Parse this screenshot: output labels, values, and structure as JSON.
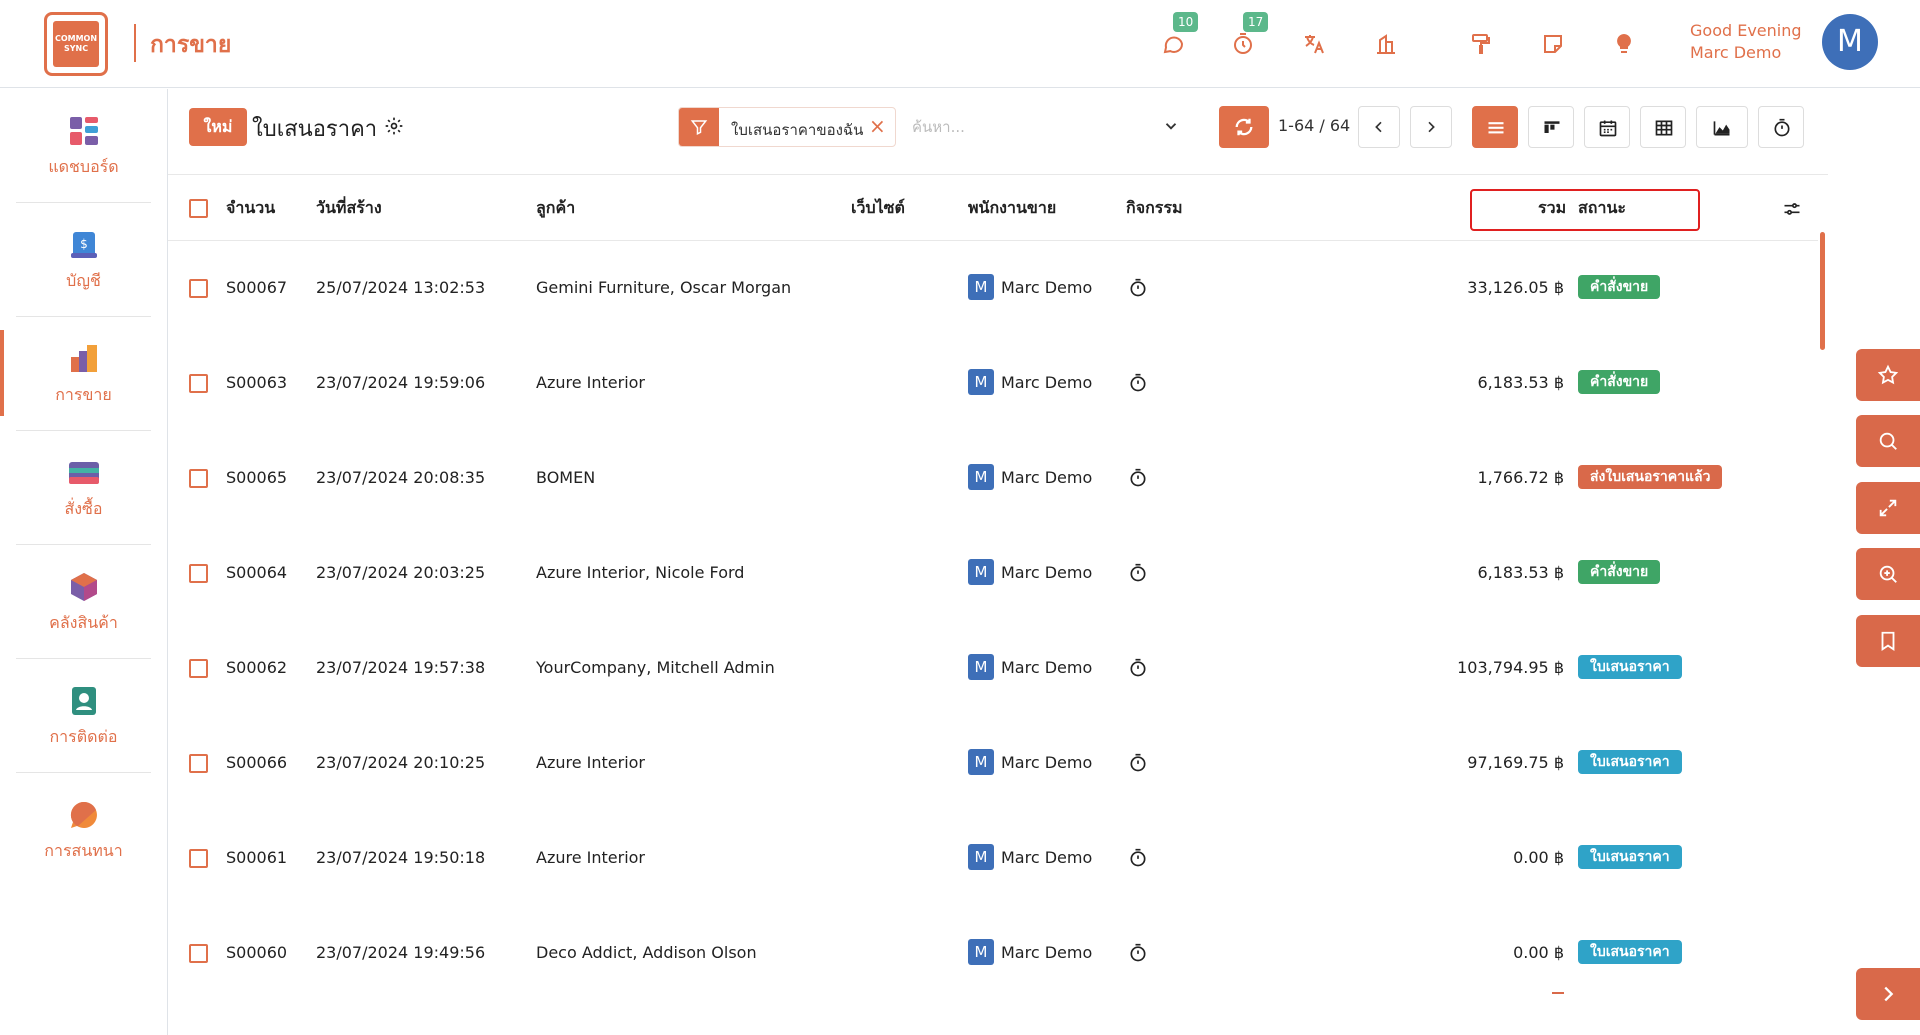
{
  "topbar": {
    "logo_text": "COMMON SYNC",
    "app_title": "การขาย",
    "messages_count": "10",
    "activities_count": "17",
    "greeting_line1": "Good Evening",
    "greeting_line2": "Marc Demo",
    "avatar_letter": "M"
  },
  "sidebar": {
    "items": [
      {
        "label": "แดชบอร์ด",
        "icon": "dashboard-icon"
      },
      {
        "label": "บัญชี",
        "icon": "accounting-icon"
      },
      {
        "label": "การขาย",
        "icon": "sales-icon"
      },
      {
        "label": "สั่งซื้อ",
        "icon": "purchase-icon"
      },
      {
        "label": "คลังสินค้า",
        "icon": "inventory-icon"
      },
      {
        "label": "การติดต่อ",
        "icon": "contacts-icon"
      },
      {
        "label": "การสนทนา",
        "icon": "discuss-icon"
      }
    ],
    "active_index": 2
  },
  "control_panel": {
    "new_label": "ใหม่",
    "title": "ใบเสนอราคา",
    "facet": "ใบเสนอราคาของฉัน",
    "search_placeholder": "ค้นหา...",
    "pager": "1-64 / 64"
  },
  "table": {
    "headers": {
      "number": "จำนวน",
      "created": "วันที่สร้าง",
      "customer": "ลูกค้า",
      "website": "เว็บไซต์",
      "salesperson": "พนักงานขาย",
      "activity": "กิจกรรม",
      "total": "รวม",
      "status": "สถานะ"
    },
    "rows": [
      {
        "number": "S00067",
        "created": "25/07/2024 13:02:53",
        "customer": "Gemini Furniture, Oscar Morgan",
        "salesperson": "Marc Demo",
        "total": "33,126.05 ฿",
        "status": "คำสั่งขาย",
        "status_color": "green"
      },
      {
        "number": "S00063",
        "created": "23/07/2024 19:59:06",
        "customer": "Azure Interior",
        "salesperson": "Marc Demo",
        "total": "6,183.53 ฿",
        "status": "คำสั่งขาย",
        "status_color": "green"
      },
      {
        "number": "S00065",
        "created": "23/07/2024 20:08:35",
        "customer": "BOMEN",
        "salesperson": "Marc Demo",
        "total": "1,766.72 ฿",
        "status": "ส่งใบเสนอราคาแล้ว",
        "status_color": "orange"
      },
      {
        "number": "S00064",
        "created": "23/07/2024 20:03:25",
        "customer": "Azure Interior, Nicole Ford",
        "salesperson": "Marc Demo",
        "total": "6,183.53 ฿",
        "status": "คำสั่งขาย",
        "status_color": "green"
      },
      {
        "number": "S00062",
        "created": "23/07/2024 19:57:38",
        "customer": "YourCompany, Mitchell Admin",
        "salesperson": "Marc Demo",
        "total": "103,794.95 ฿",
        "status": "ใบเสนอราคา",
        "status_color": "teal"
      },
      {
        "number": "S00066",
        "created": "23/07/2024 20:10:25",
        "customer": "Azure Interior",
        "salesperson": "Marc Demo",
        "total": "97,169.75 ฿",
        "status": "ใบเสนอราคา",
        "status_color": "teal"
      },
      {
        "number": "S00061",
        "created": "23/07/2024 19:50:18",
        "customer": "Azure Interior",
        "salesperson": "Marc Demo",
        "total": "0.00 ฿",
        "status": "ใบเสนอราคา",
        "status_color": "teal"
      },
      {
        "number": "S00060",
        "created": "23/07/2024 19:49:56",
        "customer": "Deco Addict, Addison Olson",
        "salesperson": "Marc Demo",
        "total": "0.00 ฿",
        "status": "ใบเสนอราคา",
        "status_color": "teal"
      }
    ],
    "salesperson_initial": "M"
  },
  "colors": {
    "accent": "#e0704a",
    "status_green": "#3fa566",
    "status_orange": "#d9694a",
    "status_teal": "#2fa3c8",
    "avatar_blue": "#3e6fb8"
  }
}
